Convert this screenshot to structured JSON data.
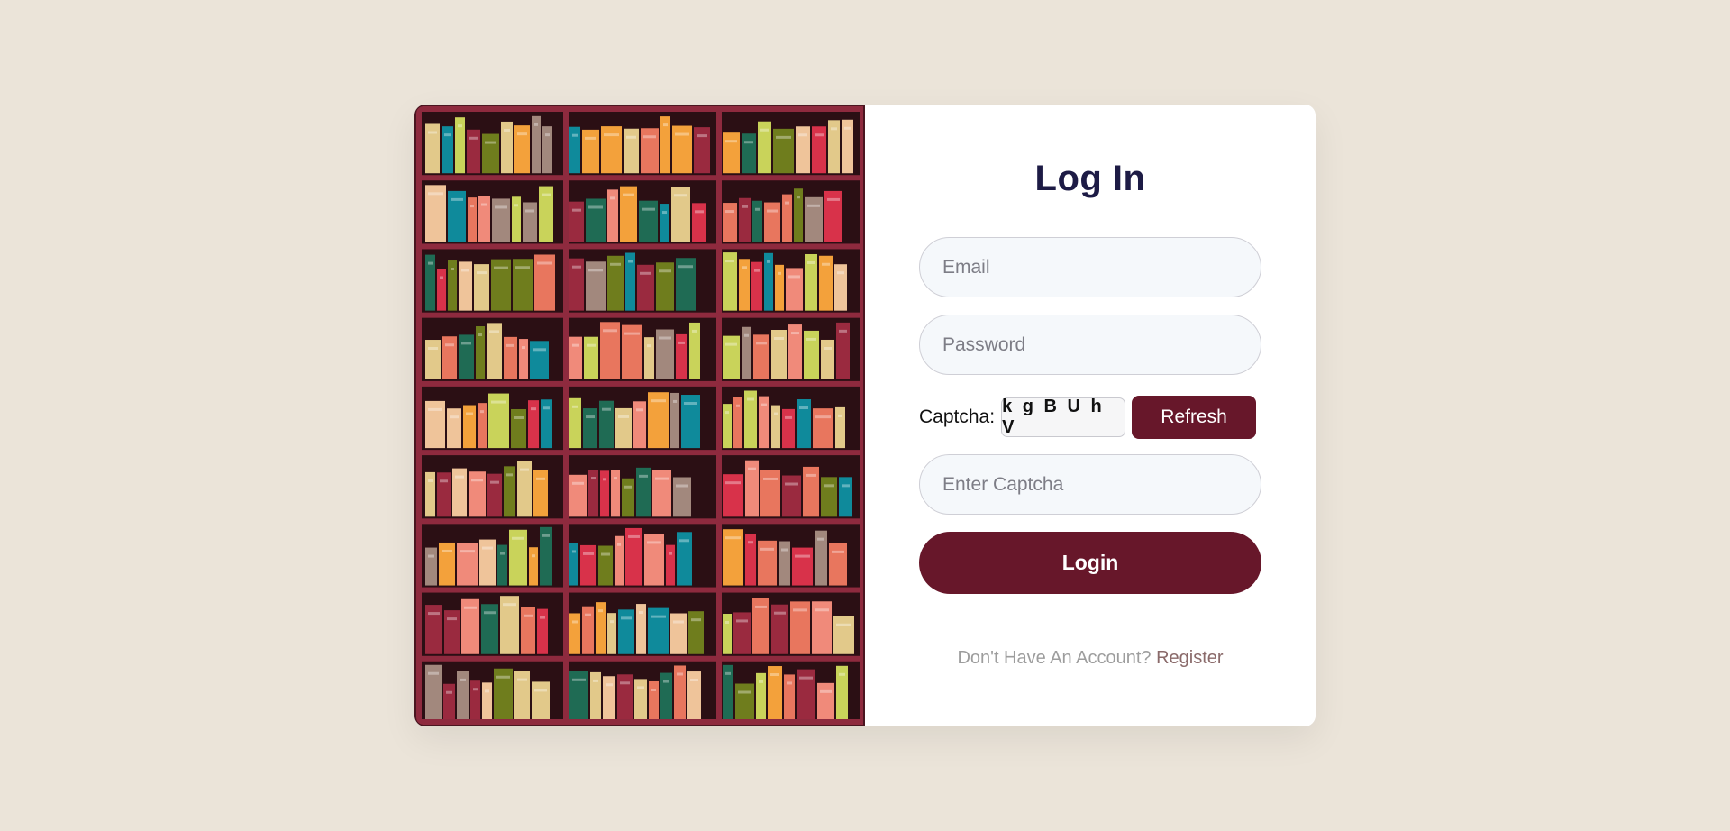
{
  "login": {
    "title": "Log In",
    "email_placeholder": "Email",
    "password_placeholder": "Password",
    "captcha_label": "Captcha:",
    "captcha_code": "k g B U h V",
    "refresh_label": "Refresh",
    "captcha_placeholder": "Enter Captcha",
    "login_label": "Login",
    "no_account_text": "Don't Have An Account?",
    "register_label": "Register"
  },
  "colors": {
    "background": "#ebe4d9",
    "brand": "#67172a",
    "title": "#1d1b45"
  }
}
